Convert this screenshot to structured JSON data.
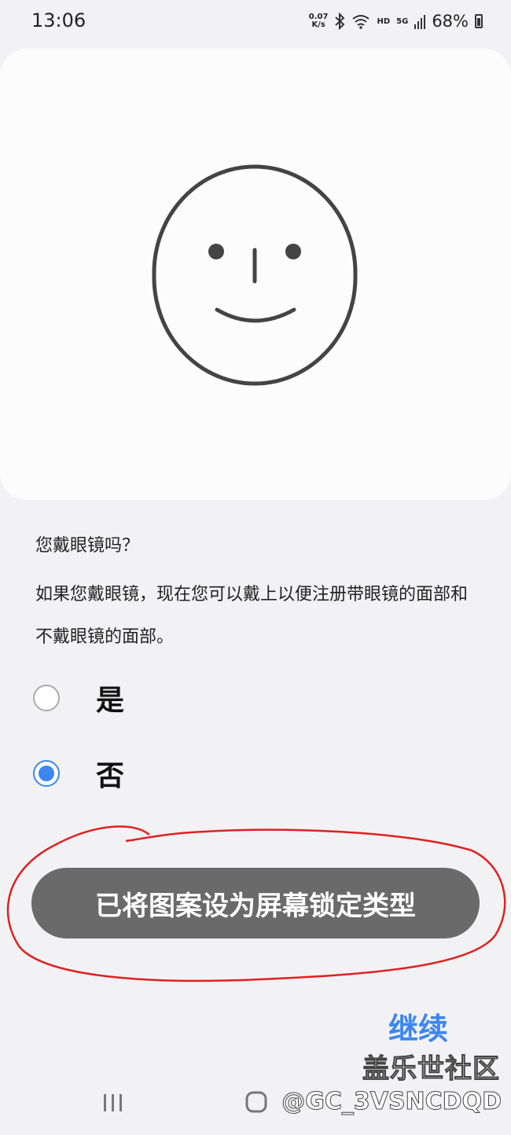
{
  "status_bar": {
    "time": "13:06",
    "net_speed_value": "0.07",
    "net_speed_unit": "K/s",
    "hd_label": "HD",
    "network_label": "5G",
    "battery": "68%",
    "icons": [
      "bluetooth-icon",
      "wifi-icon",
      "signal-icon",
      "battery-icon"
    ]
  },
  "face_card": {
    "icon": "face-outline-icon"
  },
  "question": "您戴眼镜吗？",
  "description": "如果您戴眼镜，现在您可以戴上以便注册带眼镜的面部和不戴眼镜的面部。",
  "options": [
    {
      "label": "是",
      "selected": false
    },
    {
      "label": "否",
      "selected": true
    }
  ],
  "toast": "已将图案设为屏幕锁定类型",
  "continue_label": "继续",
  "watermark": {
    "title": "盖乐世社区",
    "handle": "@GC_3VSNCDQD"
  },
  "nav": {
    "icons": [
      "recents-icon",
      "home-icon"
    ]
  },
  "colors": {
    "accent": "#3d86f0",
    "toast_bg": "#6a6a6a",
    "annotation": "#e02020",
    "page_bg": "#f2f2f4"
  }
}
